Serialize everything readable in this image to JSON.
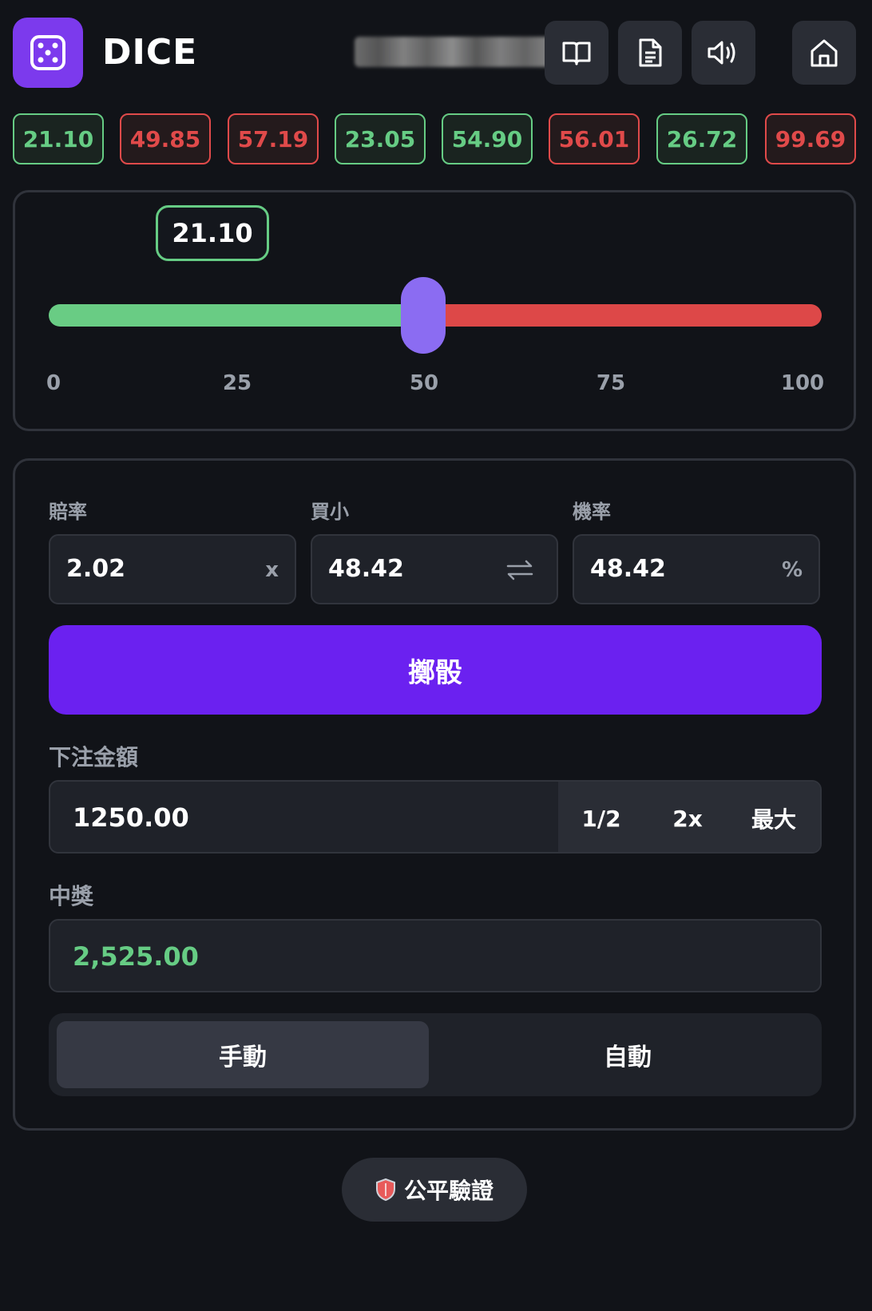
{
  "app": {
    "title": "DICE",
    "logo_icon": "dice-icon"
  },
  "header": {
    "buttons": [
      {
        "name": "rules-book-button",
        "icon": "book-open-icon"
      },
      {
        "name": "history-doc-button",
        "icon": "document-icon"
      },
      {
        "name": "sound-button",
        "icon": "speaker-icon"
      },
      {
        "name": "home-button",
        "icon": "home-icon"
      }
    ]
  },
  "history": [
    {
      "value": "21.10",
      "result": "win"
    },
    {
      "value": "49.85",
      "result": "lose"
    },
    {
      "value": "57.19",
      "result": "lose"
    },
    {
      "value": "23.05",
      "result": "win"
    },
    {
      "value": "54.90",
      "result": "win"
    },
    {
      "value": "56.01",
      "result": "lose"
    },
    {
      "value": "26.72",
      "result": "win"
    },
    {
      "value": "99.69",
      "result": "lose"
    }
  ],
  "slider": {
    "result": "21.10",
    "roll_value": 21.1,
    "target": 48.42,
    "ticks": [
      "0",
      "25",
      "50",
      "75",
      "100"
    ],
    "colors": {
      "under": "#69cc84",
      "over": "#dd4848",
      "thumb": "#8b6cf2"
    }
  },
  "fields": {
    "multiplier": {
      "label": "賠率",
      "value": "2.02",
      "suffix": "x"
    },
    "target": {
      "label": "買小",
      "value": "48.42",
      "icon": "swap-arrows-icon"
    },
    "chance": {
      "label": "機率",
      "value": "48.42",
      "suffix": "%"
    }
  },
  "roll_button": {
    "label": "擲骰",
    "color": "#6b21f0"
  },
  "bet": {
    "label": "下注金額",
    "value": "1250.00",
    "half_label": "1/2",
    "double_label": "2x",
    "max_label": "最大"
  },
  "payout": {
    "label": "中獎",
    "value": "2,525.00"
  },
  "mode": {
    "manual_label": "手動",
    "auto_label": "自動",
    "active": "manual"
  },
  "fair": {
    "label": "公平驗證",
    "icon": "shield-icon"
  }
}
